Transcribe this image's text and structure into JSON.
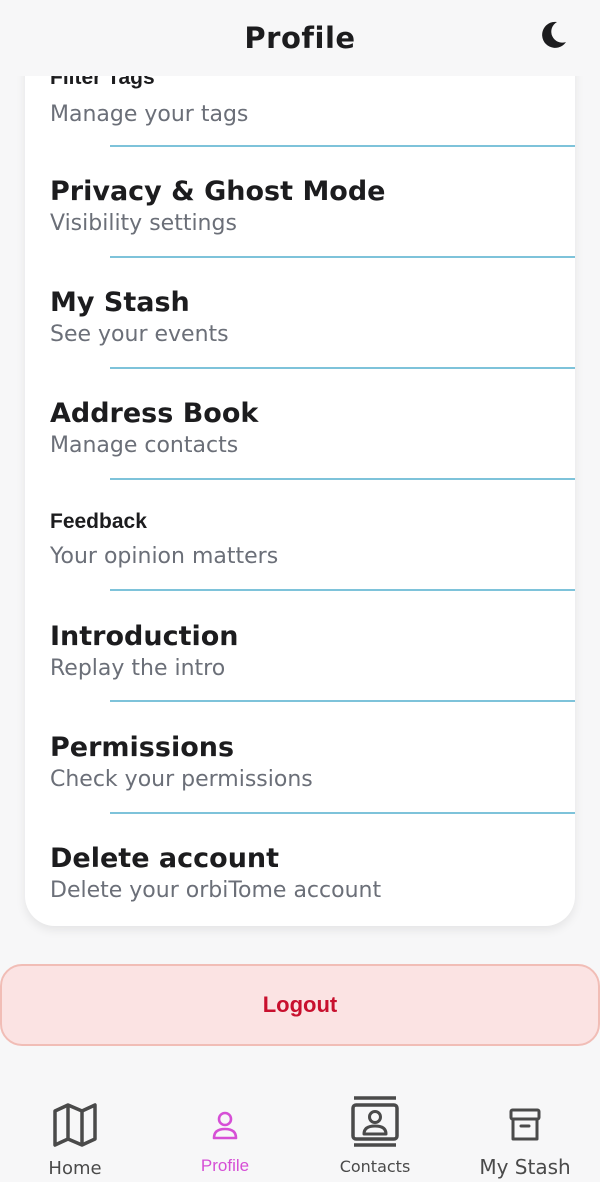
{
  "header": {
    "title": "Profile",
    "theme_icon": "moon-icon"
  },
  "menu": [
    {
      "title": "Filter Tags",
      "subtitle": "Manage your tags"
    },
    {
      "title": "Privacy & Ghost Mode",
      "subtitle": "Visibility settings"
    },
    {
      "title": "My Stash",
      "subtitle": "See your events"
    },
    {
      "title": "Address Book",
      "subtitle": "Manage contacts"
    },
    {
      "title": "Feedback",
      "subtitle": "Your opinion matters"
    },
    {
      "title": "Introduction",
      "subtitle": "Replay the intro"
    },
    {
      "title": "Permissions",
      "subtitle": "Check your permissions"
    },
    {
      "title": "Delete account",
      "subtitle": "Delete your orbiTome account"
    }
  ],
  "logout": {
    "label": "Logout",
    "color": "#c8102e",
    "background": "#fbe3e3"
  },
  "tabs": [
    {
      "label": "Home",
      "icon": "map-icon",
      "active": false
    },
    {
      "label": "Profile",
      "icon": "user-icon",
      "active": true
    },
    {
      "label": "Contacts",
      "icon": "contacts-icon",
      "active": false
    },
    {
      "label": "My Stash",
      "icon": "archive-icon",
      "active": false
    }
  ],
  "colors": {
    "accent": "#d64fd6",
    "divider": "#7ec3da",
    "inactive_tab": "#4a4a4a"
  }
}
